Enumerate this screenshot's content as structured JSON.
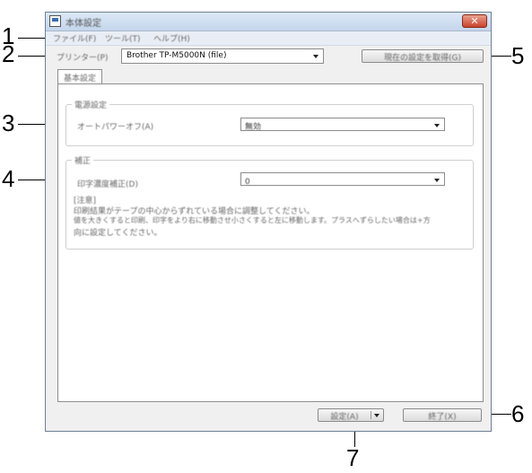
{
  "callouts": [
    "1",
    "2",
    "3",
    "4",
    "5",
    "6",
    "7"
  ],
  "window": {
    "title": "本体設定",
    "close_label": "✕"
  },
  "menu": [
    "ファイル(F)",
    "ツール(T)",
    "ヘルプ(H)"
  ],
  "printer": {
    "label": "プリンター(P)",
    "selected": "Brother TP-M5000N (file)"
  },
  "current_settings_button": "現在の設定を取得(G)",
  "tab": "基本設定",
  "power": {
    "group_title": "電源設定",
    "auto_power_off_label": "オートパワーオフ(A)",
    "auto_power_off_value": "無効"
  },
  "correction": {
    "group_title": "補正",
    "print_density_label": "印字濃度補正(D)",
    "print_density_value": "0",
    "notes": [
      "[注意]",
      "印刷結果がテープの中心からずれている場合に調整してください。",
      "値を大きくすると印刷、印字をより右に移動させ小さくすると左に移動します。プラスへずらしたい場合は+方",
      "向に設定してください。"
    ]
  },
  "footer": {
    "apply_button": "設定(A)",
    "exit_button": "終了(X)"
  }
}
